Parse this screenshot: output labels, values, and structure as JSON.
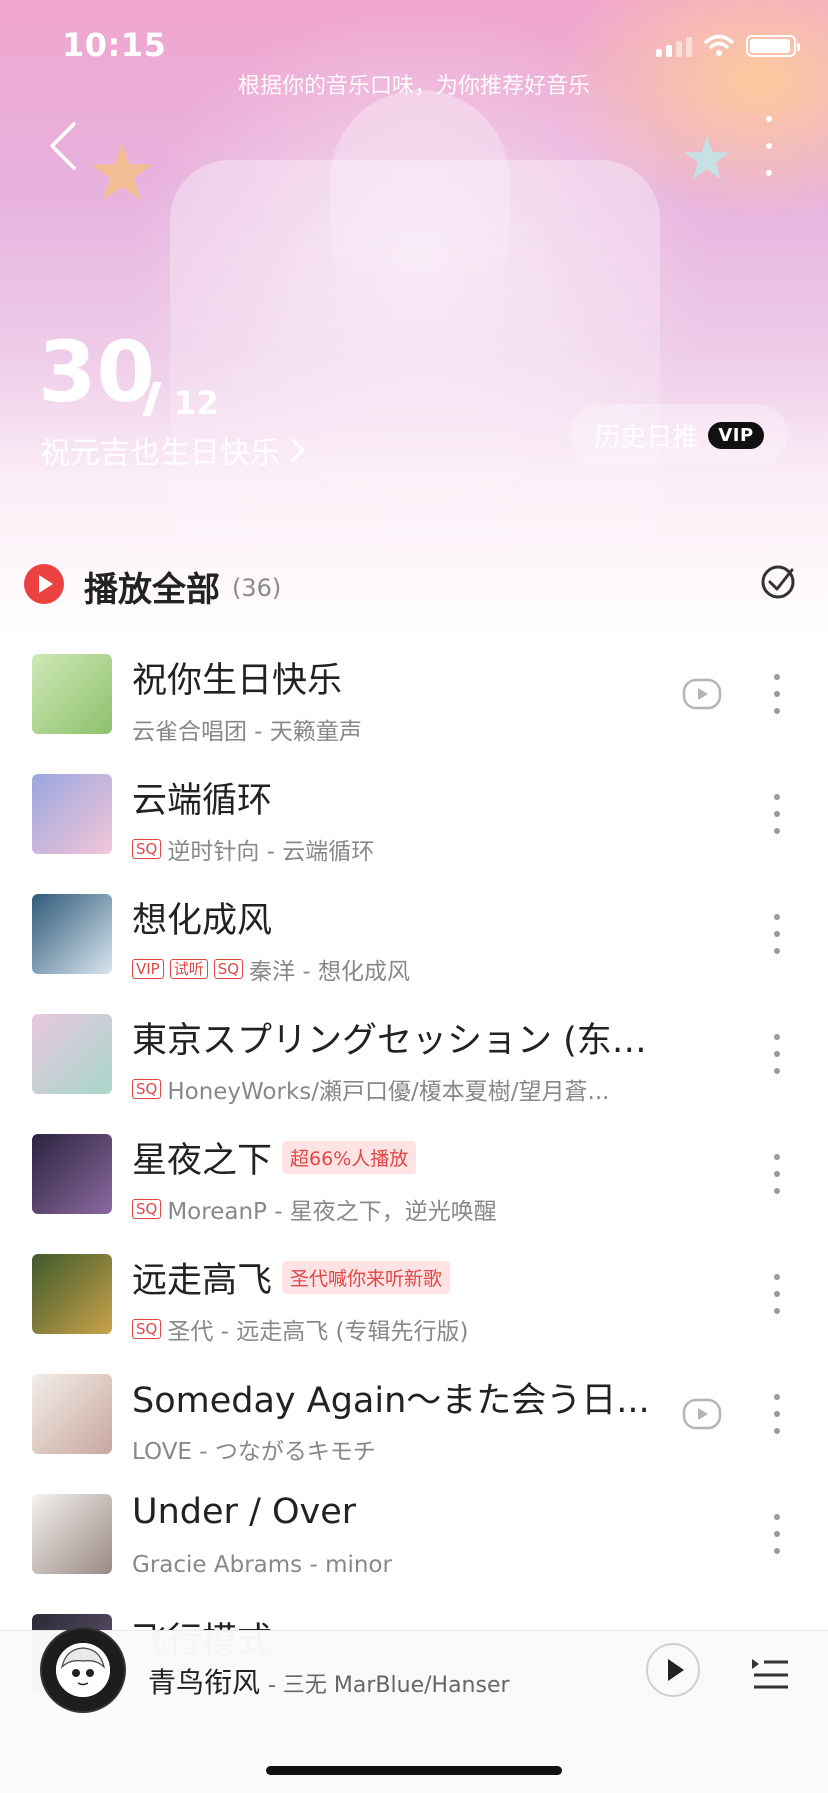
{
  "status": {
    "time": "10:15"
  },
  "header": {
    "subtitle": "根据你的音乐口味，为你推荐好音乐",
    "day": "30",
    "month": "12",
    "greeting": "祝元吉也生日快乐",
    "history_label": "历史日推",
    "vip_label": "VIP"
  },
  "playall": {
    "label": "播放全部",
    "count": "(36)"
  },
  "songs": [
    {
      "title": "祝你生日快乐",
      "badge": "",
      "tags": [],
      "meta": "云雀合唱团 - 天籁童声",
      "has_mv": true,
      "cover": [
        "#cfe9b8",
        "#8cc06b"
      ]
    },
    {
      "title": "云端循环",
      "badge": "",
      "tags": [
        "SQ"
      ],
      "meta": "逆时针向 - 云端循环",
      "has_mv": false,
      "cover": [
        "#9aa6e0",
        "#f3c6d8"
      ]
    },
    {
      "title": "想化成风",
      "badge": "",
      "tags": [
        "VIP",
        "试听",
        "SQ"
      ],
      "meta": "秦洋 - 想化成风",
      "has_mv": false,
      "cover": [
        "#2f5a7a",
        "#d9e6ef"
      ]
    },
    {
      "title": "東京スプリングセッション (东京...",
      "badge": "",
      "tags": [
        "SQ"
      ],
      "meta": "HoneyWorks/瀬戸口優/榎本夏樹/望月蒼...",
      "has_mv": false,
      "cover": [
        "#e9c7df",
        "#a7d7c9"
      ]
    },
    {
      "title": "星夜之下",
      "badge": "超66%人播放",
      "tags": [
        "SQ"
      ],
      "meta": "MoreanP - 星夜之下，逆光唤醒",
      "has_mv": false,
      "cover": [
        "#2b2340",
        "#8c6aa0"
      ]
    },
    {
      "title": "远走高飞",
      "badge": "圣代喊你来听新歌",
      "tags": [
        "SQ"
      ],
      "meta": "圣代 - 远走高飞 (专辑先行版)",
      "has_mv": false,
      "cover": [
        "#3f5a2c",
        "#c9a24a"
      ]
    },
    {
      "title": "Someday Again～また会う日...",
      "badge": "",
      "tags": [],
      "meta": "LOVE - つながるキモチ",
      "has_mv": true,
      "cover": [
        "#f2eee8",
        "#c9a7a0"
      ]
    },
    {
      "title": "Under / Over",
      "badge": "",
      "tags": [],
      "meta": "Gracie Abrams - minor",
      "has_mv": false,
      "cover": [
        "#f4f2ef",
        "#9a8a84"
      ]
    },
    {
      "title": "飞行模式",
      "badge": "",
      "tags": [],
      "meta": "",
      "has_mv": false,
      "cover": [
        "#2a2a35",
        "#6a5a7a"
      ]
    }
  ],
  "player": {
    "title": "青鸟衔风",
    "artist": "- 三无 MarBlue/Hanser"
  },
  "colors": {
    "accent": "#ec4141",
    "tag": "#e04848"
  },
  "icons": [
    "back-icon",
    "more-icon",
    "play-icon",
    "select-check-icon",
    "mv-icon",
    "playlist-icon"
  ]
}
